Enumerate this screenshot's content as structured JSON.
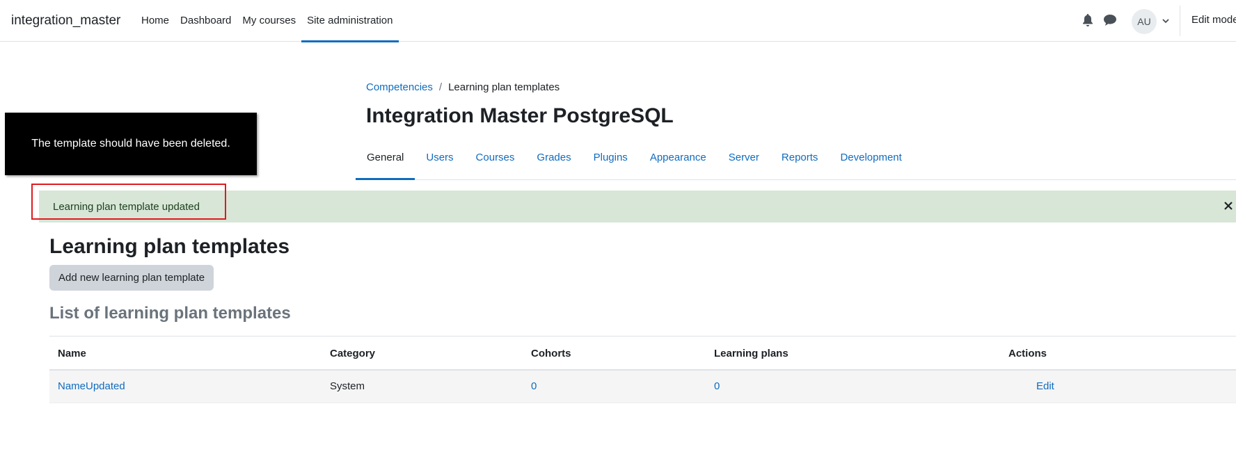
{
  "navbar": {
    "brand": "integration_master",
    "items": [
      {
        "label": "Home"
      },
      {
        "label": "Dashboard"
      },
      {
        "label": "My courses"
      },
      {
        "label": "Site administration"
      }
    ],
    "user_initials": "AU",
    "edit_mode_label": "Edit mode"
  },
  "breadcrumb": {
    "parent": "Competencies",
    "current": "Learning plan templates"
  },
  "page_title": "Integration Master PostgreSQL",
  "secondary_nav": {
    "items": [
      {
        "label": "General"
      },
      {
        "label": "Users"
      },
      {
        "label": "Courses"
      },
      {
        "label": "Grades"
      },
      {
        "label": "Plugins"
      },
      {
        "label": "Appearance"
      },
      {
        "label": "Server"
      },
      {
        "label": "Reports"
      },
      {
        "label": "Development"
      }
    ]
  },
  "overlay": {
    "message": "The template should have been deleted."
  },
  "alert": {
    "message": "Learning plan template updated"
  },
  "main": {
    "heading": "Learning plan templates",
    "add_button": "Add new learning plan template",
    "list_heading": "List of learning plan templates",
    "table": {
      "headers": [
        "Name",
        "Category",
        "Cohorts",
        "Learning plans",
        "Actions"
      ],
      "rows": [
        {
          "name": "NameUpdated",
          "category": "System",
          "cohorts": "0",
          "learning_plans": "0",
          "action": "Edit"
        }
      ]
    }
  },
  "colors": {
    "link": "#0f6cbf",
    "alert_bg": "#d7e6d7",
    "highlight": "#e0191c"
  }
}
